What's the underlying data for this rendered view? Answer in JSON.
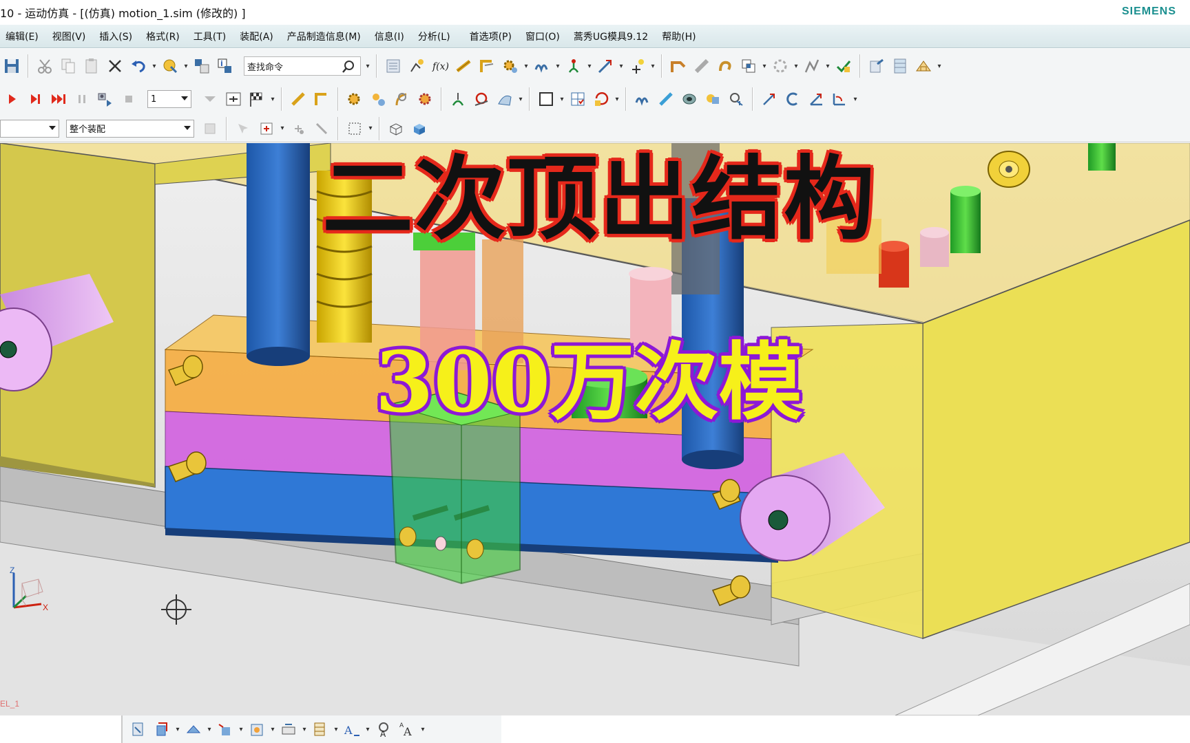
{
  "window": {
    "title": "10 - 运动仿真 - [(仿真) motion_1.sim  (修改的) ]",
    "brand": "SIEMENS"
  },
  "menu": [
    "编辑(E)",
    "视图(V)",
    "插入(S)",
    "格式(R)",
    "工具(T)",
    "装配(A)",
    "产品制造信息(M)",
    "信息(I)",
    "分析(L)",
    "首选项(P)",
    "窗口(O)",
    "蒿秀UG模具9.12",
    "帮助(H)"
  ],
  "toolbar": {
    "search_placeholder": "查找命令",
    "step_value": "1",
    "assembly_filter": "整个装配"
  },
  "overlay": {
    "title": "二次顶出结构",
    "subtitle": "300万次模"
  },
  "viewport": {
    "triad_z": "Z",
    "triad_x": "X",
    "model_label": "EL_1"
  },
  "colors": {
    "accent": "#1a8f8f",
    "menubar": "#dde9ec",
    "title_outline": "#e5281b",
    "subtitle_fill": "#f6f01a",
    "subtitle_outline": "#8d18d6"
  }
}
